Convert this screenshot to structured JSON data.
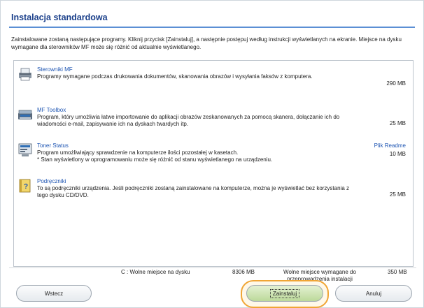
{
  "page": {
    "title": "Instalacja standardowa",
    "intro": "Zainstalowane zostaną następujące programy. Kliknij przycisk [Zainstaluj], a następnie postępuj według instrukcji wyświetlanych na ekranie. Miejsce na dysku wymagane dla sterowników MF może się różnić od aktualnie wyświetlanego."
  },
  "items": [
    {
      "name": "Sterowniki MF",
      "icon": "printer-icon",
      "desc": "Programy wymagane podczas drukowania dokumentów, skanowania obrazów i wysyłania faksów z komputera.",
      "size": "290 MB"
    },
    {
      "name": "MF Toolbox",
      "icon": "scanner-icon",
      "desc": "Program, który umożliwia łatwe importowanie do aplikacji obrazów zeskanowanych za pomocą skanera, dołączanie ich do wiadomości e-mail, zapisywanie ich na dyskach twardych itp.",
      "size": "25 MB"
    },
    {
      "name": "Toner Status",
      "icon": "toner-status-icon",
      "desc": "Program umożliwiający sprawdzenie na komputerze ilości pozostałej w kasetach.",
      "note": "* Stan wyświetlony w oprogramowaniu może się różnić od stanu wyświetlanego na urządzeniu.",
      "size": "10 MB",
      "link": "Plik Readme"
    },
    {
      "name": "Podręczniki",
      "icon": "manual-icon",
      "desc": "To są podręczniki urządzenia. Jeśli podręczniki zostaną zainstalowane na komputerze, można je wyświetlać bez korzystania z tego dysku CD/DVD.",
      "size": "25 MB"
    }
  ],
  "disk": {
    "free_label": "C : Wolne miejsce na dysku",
    "free_value": "8306 MB",
    "required_label": "Wolne miejsce wymagane do przeprowadzenia instalacji",
    "required_value": "350 MB"
  },
  "buttons": {
    "back": "Wstecz",
    "install": "Zainstaluj",
    "cancel": "Anuluj"
  },
  "colors": {
    "title": "#1a3f8a",
    "link": "#1f56b3",
    "highlight": "#f0a535"
  }
}
